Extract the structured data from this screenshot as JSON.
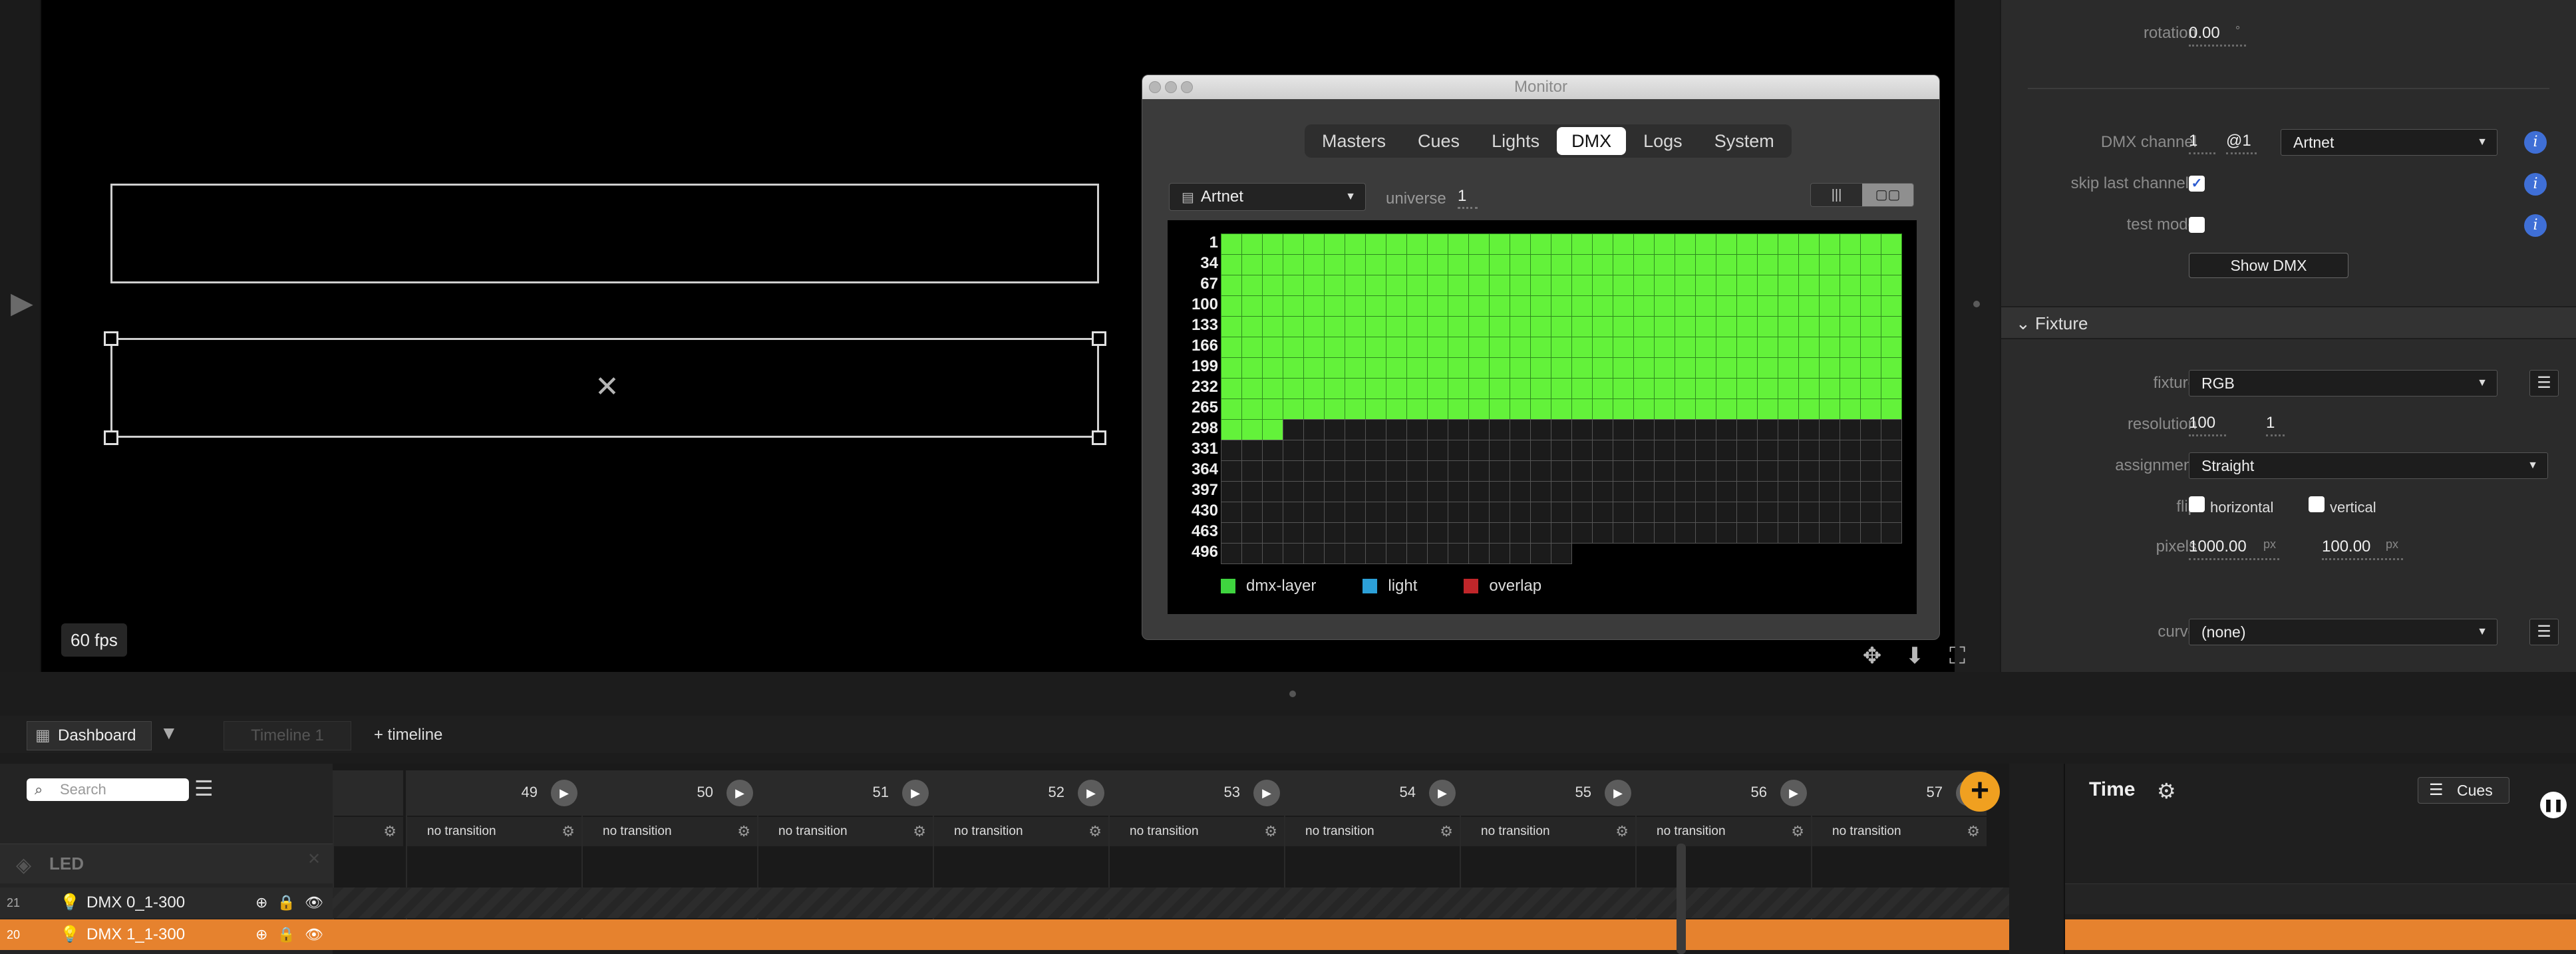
{
  "stage": {
    "fps": "60 fps",
    "expand_icon": "triangle-right-icon"
  },
  "monitor": {
    "title": "Monitor",
    "tabs": [
      "Masters",
      "Cues",
      "Lights",
      "DMX",
      "Logs",
      "System"
    ],
    "active_tab": "DMX",
    "protocol": "Artnet",
    "universe_label": "universe",
    "universe_value": "1",
    "view_modes": [
      "|||",
      "▢▢"
    ],
    "row_labels": [
      "1",
      "34",
      "67",
      "100",
      "133",
      "166",
      "199",
      "232",
      "265",
      "298",
      "331",
      "364",
      "397",
      "430",
      "463",
      "496"
    ],
    "columns_per_row": 33,
    "total_channels": 512,
    "used_channels": 300,
    "legend": [
      {
        "label": "dmx-layer",
        "color": "#3fd43f"
      },
      {
        "label": "light",
        "color": "#2ca0d8"
      },
      {
        "label": "overlap",
        "color": "#c0262a"
      }
    ],
    "colors": {
      "active": "#63f23a",
      "inactive": "#1b1b1b",
      "grid_line": "#555555"
    }
  },
  "inspector": {
    "rotation_label": "rotation",
    "rotation_value": "0.00",
    "rotation_unit": "°",
    "dmx_channel_label": "DMX channel",
    "dmx_channel_value": "1",
    "dmx_channel_universe": "@1",
    "dmx_protocol": "Artnet",
    "skip_last_label": "skip last channels",
    "skip_last_checked": true,
    "test_mode_label": "test mode",
    "test_mode_checked": false,
    "show_dmx_button": "Show DMX",
    "fixture_section": "Fixture",
    "fixture_label": "fixture",
    "fixture_value": "RGB",
    "resolution_label": "resolution",
    "resolution_x": "100",
    "resolution_y": "1",
    "assignment_label": "assignment",
    "assignment_value": "Straight",
    "flip_label": "flip",
    "flip_horizontal": "horizontal",
    "flip_vertical": "vertical",
    "pixels_label": "pixels",
    "pixels_x": "1000.00",
    "pixels_y": "100.00",
    "pixels_unit": "px",
    "curve_label": "curve",
    "curve_value": "(none)",
    "info_icon": "i"
  },
  "dashboard": {
    "tab_label": "Dashboard",
    "timeline_tab": "Timeline 1",
    "add_timeline": "+ timeline"
  },
  "cues": {
    "search_placeholder": "Search",
    "layer_group": "LED",
    "layers": [
      {
        "num": "21",
        "name": "DMX 0_1-300",
        "highlight": false
      },
      {
        "num": "20",
        "name": "DMX 1_1-300",
        "highlight": true
      }
    ],
    "columns": [
      {
        "number": "49",
        "transition": "no transition"
      },
      {
        "number": "50",
        "transition": "no transition"
      },
      {
        "number": "51",
        "transition": "no transition"
      },
      {
        "number": "52",
        "transition": "no transition"
      },
      {
        "number": "53",
        "transition": "no transition"
      },
      {
        "number": "54",
        "transition": "no transition"
      },
      {
        "number": "55",
        "transition": "no transition"
      },
      {
        "number": "56",
        "transition": "no transition"
      },
      {
        "number": "57",
        "transition": "no transition"
      }
    ],
    "highlight_color": "#e6822e"
  },
  "time_panel": {
    "title": "Time",
    "cues_button": "Cues"
  }
}
